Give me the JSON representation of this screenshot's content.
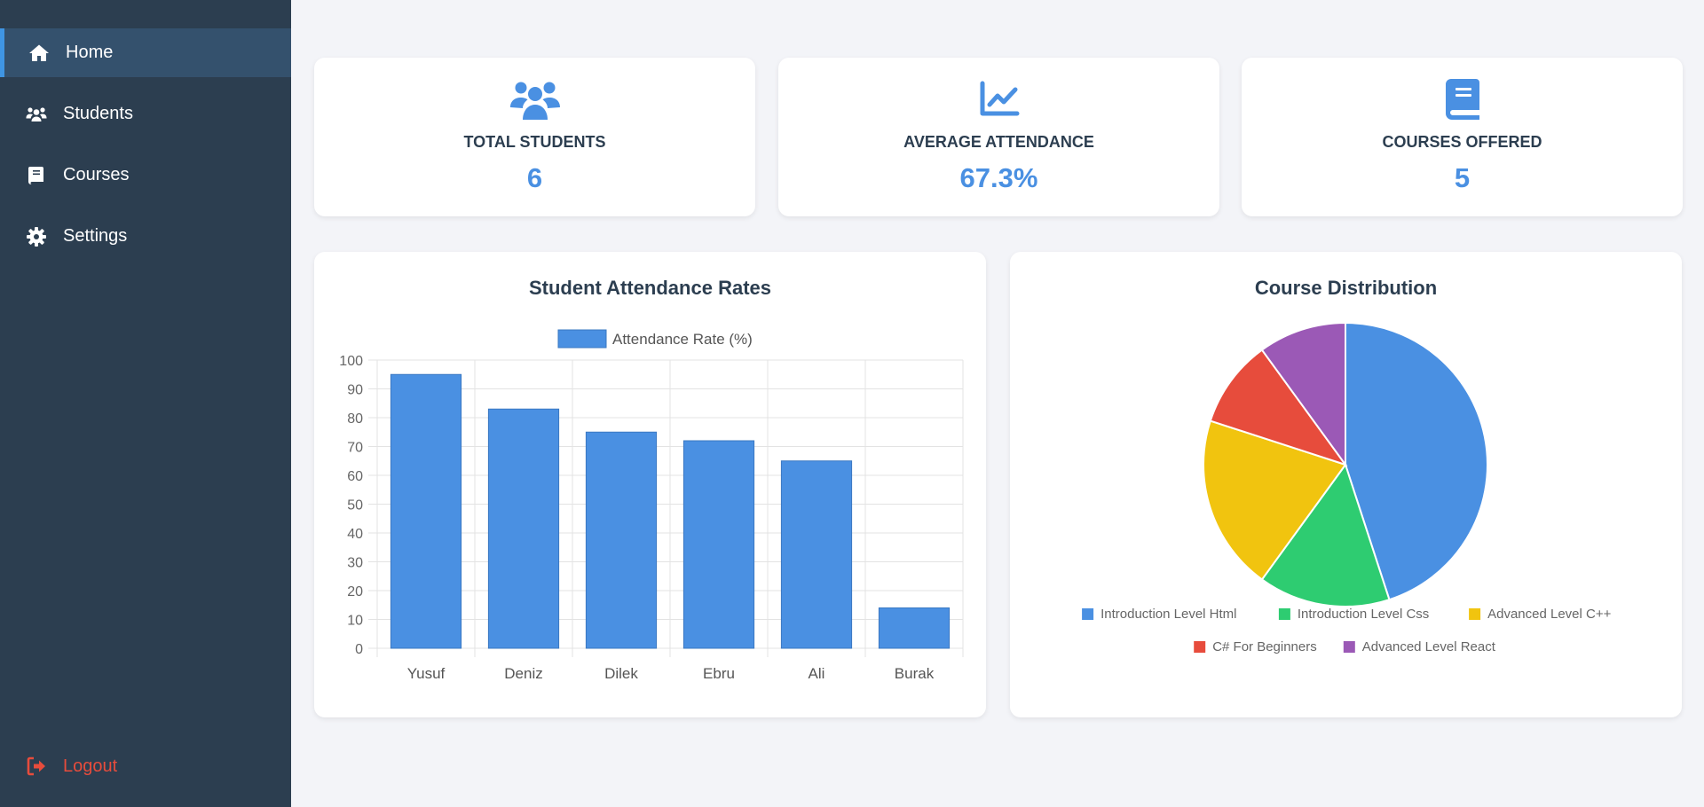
{
  "sidebar": {
    "items": [
      {
        "label": "Home",
        "icon": "home-icon",
        "active": true
      },
      {
        "label": "Students",
        "icon": "users-icon",
        "active": false
      },
      {
        "label": "Courses",
        "icon": "book-icon",
        "active": false
      },
      {
        "label": "Settings",
        "icon": "gear-icon",
        "active": false
      }
    ],
    "logout_label": "Logout"
  },
  "stats": [
    {
      "label": "TOTAL STUDENTS",
      "value": "6",
      "icon": "users-icon"
    },
    {
      "label": "AVERAGE ATTENDANCE",
      "value": "67.3%",
      "icon": "chart-line-icon"
    },
    {
      "label": "COURSES OFFERED",
      "value": "5",
      "icon": "book-icon"
    }
  ],
  "colors": {
    "sidebar_bg": "#2c3e50",
    "accent": "#4a90e2",
    "logout": "#e74c3c",
    "heading": "#2c3e50"
  },
  "chart_data": [
    {
      "type": "bar",
      "title": "Student Attendance Rates",
      "categories": [
        "Yusuf",
        "Deniz",
        "Dilek",
        "Ebru",
        "Ali",
        "Burak"
      ],
      "series": [
        {
          "name": "Attendance Rate (%)",
          "values": [
            95,
            83,
            75,
            72,
            65,
            14
          ],
          "color": "#4a90e2"
        }
      ],
      "ylim": [
        0,
        100
      ],
      "yticks": [
        0,
        10,
        20,
        30,
        40,
        50,
        60,
        70,
        80,
        90,
        100
      ],
      "grid": true,
      "legend": "top"
    },
    {
      "type": "pie",
      "title": "Course Distribution",
      "labels": [
        "Introduction Level Html",
        "Introduction Level Css",
        "Advanced Level C++",
        "C# For Beginners",
        "Advanced Level React"
      ],
      "values": [
        45,
        15,
        20,
        10,
        10
      ],
      "colors": [
        "#4a90e2",
        "#2ecc71",
        "#f1c40f",
        "#e74c3c",
        "#9b59b6"
      ],
      "legend": "bottom"
    }
  ]
}
